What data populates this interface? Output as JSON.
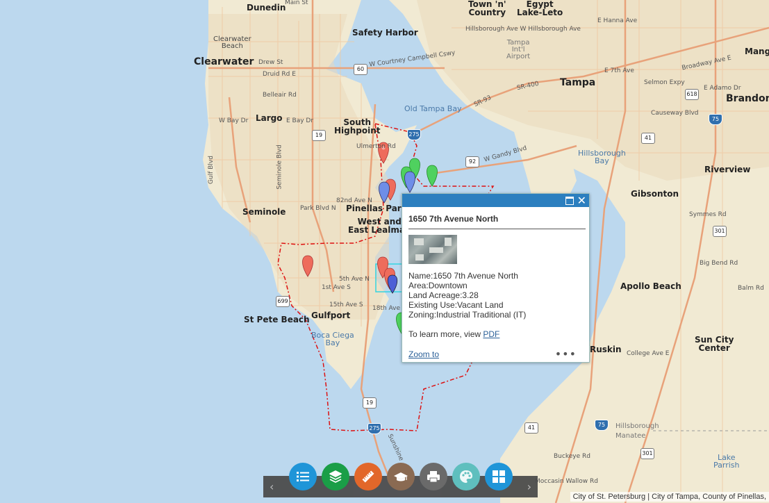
{
  "popup": {
    "title": "1650 7th Avenue North",
    "fields": [
      {
        "label": "Name:",
        "value": "1650 7th Avenue North"
      },
      {
        "label": "Area:",
        "value": "Downtown"
      },
      {
        "label": "Land Acreage:",
        "value": "3.28"
      },
      {
        "label": "Existing Use:",
        "value": "Vacant Land"
      },
      {
        "label": "Zoning:",
        "value": "Industrial Traditional (IT)"
      }
    ],
    "learn_prefix": "To learn more, view",
    "pdf_link": "PDF",
    "zoom_link": "Zoom to",
    "more": "•••",
    "maximize_icon": "maximize-icon",
    "close_icon": "close-icon",
    "close_glyph": "✕"
  },
  "toolbar": {
    "prev": "‹",
    "next": "›",
    "buttons": [
      {
        "name": "legend-button",
        "icon": "list-icon",
        "color": "#1f95d8"
      },
      {
        "name": "layers-button",
        "icon": "layers-icon",
        "color": "#1a9e47"
      },
      {
        "name": "measure-button",
        "icon": "ruler-icon",
        "color": "#e2672a"
      },
      {
        "name": "about-button",
        "icon": "graduation-cap-icon",
        "color": "#8a6a52"
      },
      {
        "name": "print-button",
        "icon": "printer-icon",
        "color": "#6a6a6a"
      },
      {
        "name": "basemap-button",
        "icon": "palette-icon",
        "color": "#5fbfbe"
      },
      {
        "name": "basemap-gallery-button",
        "icon": "grid-icon",
        "color": "#1f95d8"
      }
    ]
  },
  "attribution": "City of St. Petersburg | City of Tampa, County of Pinellas,",
  "map": {
    "places": [
      {
        "id": "dunedin",
        "text": "Dunedin"
      },
      {
        "id": "clearwater-beach",
        "text": "Clearwater\nBeach"
      },
      {
        "id": "clearwater",
        "text": "Clearwater"
      },
      {
        "id": "largo",
        "text": "Largo"
      },
      {
        "id": "seminole",
        "text": "Seminole"
      },
      {
        "id": "safety-harbor",
        "text": "Safety Harbor"
      },
      {
        "id": "south-highpoint",
        "text": "South\nHighpoint"
      },
      {
        "id": "pinellas-park",
        "text": "Pinellas Park"
      },
      {
        "id": "west-east-lealman",
        "text": "West and\nEast Lealman"
      },
      {
        "id": "gulfport",
        "text": "Gulfport"
      },
      {
        "id": "st-pete-beach",
        "text": "St Pete Beach"
      },
      {
        "id": "town-n-country",
        "text": "Town 'n'\nCountry"
      },
      {
        "id": "egypt-lake-leto",
        "text": "Egypt\nLake-Leto"
      },
      {
        "id": "tampa",
        "text": "Tampa"
      },
      {
        "id": "tampa-airport",
        "text": "Tampa\nInt'l\nAirport"
      },
      {
        "id": "brandon",
        "text": "Brandon"
      },
      {
        "id": "riverview",
        "text": "Riverview"
      },
      {
        "id": "gibsonton",
        "text": "Gibsonton"
      },
      {
        "id": "apollo-beach",
        "text": "Apollo Beach"
      },
      {
        "id": "ruskin",
        "text": "Ruskin"
      },
      {
        "id": "sun-city-center",
        "text": "Sun City\nCenter"
      },
      {
        "id": "mango",
        "text": "Mango"
      },
      {
        "id": "manatee",
        "text": "Manatee"
      },
      {
        "id": "hillsborough-county",
        "text": "Hillsborough"
      },
      {
        "id": "lake-parrish",
        "text": "Lake\nParrish"
      }
    ],
    "water": [
      {
        "id": "old-tampa-bay",
        "text": "Old Tampa Bay"
      },
      {
        "id": "hillsborough-bay",
        "text": "Hillsborough\nBay"
      },
      {
        "id": "boca-ciega-bay",
        "text": "Boca Ciega\nBay"
      }
    ],
    "roads": [
      {
        "id": "w-courtney-campbell",
        "text": "W Courtney Campbell Cswy"
      },
      {
        "id": "hillsborough-ave",
        "text": "Hillsborough Ave W Hillsborough Ave"
      },
      {
        "id": "sr-93",
        "text": "SR-93"
      },
      {
        "id": "sr-400",
        "text": "SR-400"
      },
      {
        "id": "w-gandy-blvd",
        "text": "W Gandy Blvd"
      },
      {
        "id": "selmon-expy",
        "text": "Selmon Expy"
      },
      {
        "id": "causeway-blvd",
        "text": "Causeway Blvd"
      },
      {
        "id": "broadway-ave",
        "text": "Broadway Ave E"
      },
      {
        "id": "w-bay-dr",
        "text": "W Bay Dr"
      },
      {
        "id": "e-bay-dr",
        "text": "E Bay Dr"
      },
      {
        "id": "ulmerton-rd",
        "text": "Ulmerton Rd"
      },
      {
        "id": "82nd-ave-n",
        "text": "82nd Ave N"
      },
      {
        "id": "park-blvd-n",
        "text": "Park Blvd N"
      },
      {
        "id": "5th-ave-n",
        "text": "5th Ave N"
      },
      {
        "id": "1st-ave-s",
        "text": "1st Ave S"
      },
      {
        "id": "15th-ave-s",
        "text": "15th Ave S"
      },
      {
        "id": "18th-ave",
        "text": "18th Ave"
      },
      {
        "id": "drew-st",
        "text": "Drew St"
      },
      {
        "id": "druid-rd-e",
        "text": "Druid Rd E"
      },
      {
        "id": "belleair-rd",
        "text": "Belleair Rd"
      },
      {
        "id": "main-st",
        "text": "Main St"
      },
      {
        "id": "gulf-blvd",
        "text": "Gulf Blvd"
      },
      {
        "id": "seminole-blvd",
        "text": "Seminole Blvd"
      },
      {
        "id": "symmes-rd",
        "text": "Symmes Rd"
      },
      {
        "id": "big-bend-rd",
        "text": "Big Bend Rd"
      },
      {
        "id": "balm-rd",
        "text": "Balm Rd"
      },
      {
        "id": "college-ave-e",
        "text": "College Ave E"
      },
      {
        "id": "buckeye-rd",
        "text": "Buckeye Rd"
      },
      {
        "id": "moccasin-wallow-rd",
        "text": "Moccasin Wallow Rd"
      },
      {
        "id": "sunshine",
        "text": "Sunshine"
      },
      {
        "id": "adamo-dr",
        "text": "E Adamo Dr"
      },
      {
        "id": "e-7th-ave",
        "text": "E 7th Ave"
      },
      {
        "id": "e-hanna-ave",
        "text": "E Hanna Ave"
      }
    ],
    "shields": [
      {
        "id": "us-60",
        "text": "60"
      },
      {
        "id": "us-19-north",
        "text": "19"
      },
      {
        "id": "us-92",
        "text": "92"
      },
      {
        "id": "us-19-south",
        "text": "19"
      },
      {
        "id": "sr-699",
        "text": "699"
      },
      {
        "id": "i-275",
        "text": "275"
      },
      {
        "id": "i-75-north",
        "text": "75"
      },
      {
        "id": "i-75-south",
        "text": "75"
      },
      {
        "id": "cr-618",
        "text": "618"
      },
      {
        "id": "sr-41",
        "text": "41"
      },
      {
        "id": "cr-301",
        "text": "301"
      },
      {
        "id": "us-41-south",
        "text": "41"
      },
      {
        "id": "us-301-south",
        "text": "301"
      },
      {
        "id": "i-275-north",
        "text": "275"
      }
    ]
  }
}
